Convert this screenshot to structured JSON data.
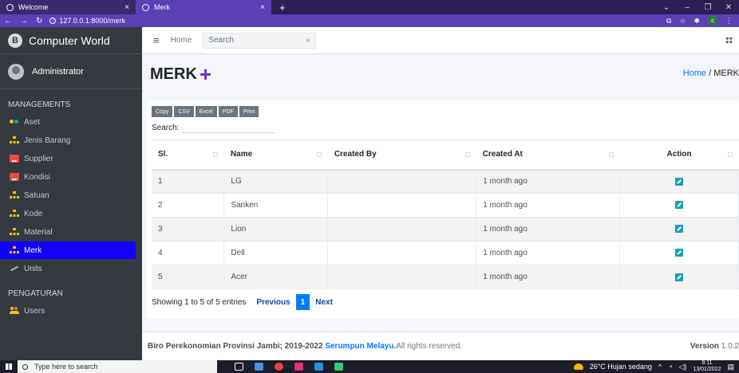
{
  "browser": {
    "tabs": [
      {
        "label": "Welcome",
        "close": "×"
      },
      {
        "label": "Merk",
        "close": "×"
      }
    ],
    "new_tab": "+",
    "url": "127.0.0.1:8000/merk",
    "profile_initial": "c"
  },
  "sidebar": {
    "brand": "Computer World",
    "brand_logo": "B",
    "user": "Administrator",
    "section_managements": "MANAGEMENTS",
    "items": [
      {
        "label": "Aset",
        "icon": "infinity-icon"
      },
      {
        "label": "Jenis Barang",
        "icon": "sitemap-icon"
      },
      {
        "label": "Supplier",
        "icon": "truck-icon"
      },
      {
        "label": "Kondisi",
        "icon": "truck-icon"
      },
      {
        "label": "Satuan",
        "icon": "sitemap-icon"
      },
      {
        "label": "Kode",
        "icon": "sitemap-icon"
      },
      {
        "label": "Material",
        "icon": "sitemap-icon"
      },
      {
        "label": "Merk",
        "icon": "sitemap-icon",
        "active": true
      },
      {
        "label": "Units",
        "icon": "pen-icon"
      }
    ],
    "section_pengaturan": "PENGATURAN",
    "items2": [
      {
        "label": "Users",
        "icon": "users-icon"
      }
    ]
  },
  "navbar": {
    "home": "Home",
    "search_placeholder": "Search"
  },
  "header": {
    "title": "MERK",
    "plus": "+",
    "breadcrumb_home": "Home",
    "breadcrumb_sep": " / ",
    "breadcrumb_current": "MERK"
  },
  "table_tools": {
    "buttons": [
      "Copy",
      "CSV",
      "Excel",
      "PDF",
      "Print"
    ],
    "search_label": "Search:"
  },
  "table": {
    "columns": [
      "Sl.",
      "Name",
      "Created By",
      "Created At",
      "Action"
    ],
    "rows": [
      {
        "sl": "1",
        "name": "LG",
        "created_by": "",
        "created_at": "1 month ago"
      },
      {
        "sl": "2",
        "name": "Sanken",
        "created_by": "",
        "created_at": "1 month ago"
      },
      {
        "sl": "3",
        "name": "Lion",
        "created_by": "",
        "created_at": "1 month ago"
      },
      {
        "sl": "4",
        "name": "Dell",
        "created_by": "",
        "created_at": "1 month ago"
      },
      {
        "sl": "5",
        "name": "Acer",
        "created_by": "",
        "created_at": "1 month ago"
      }
    ]
  },
  "pagination": {
    "info": "Showing 1 to 5 of 5 entries",
    "previous": "Previous",
    "page": "1",
    "next": "Next"
  },
  "footer": {
    "text": "Biro Perekonomian Provinsi Jambi; 2019-2022",
    "link": "Serumpun Melayu.",
    "rights": " All rights reserved.",
    "version_label": "Version",
    "version_value": "1.0.2"
  },
  "taskbar": {
    "search": "Type here to search",
    "weather": "26°C  Hujan sedang",
    "time": "9:11",
    "date": "13/01/2022"
  }
}
